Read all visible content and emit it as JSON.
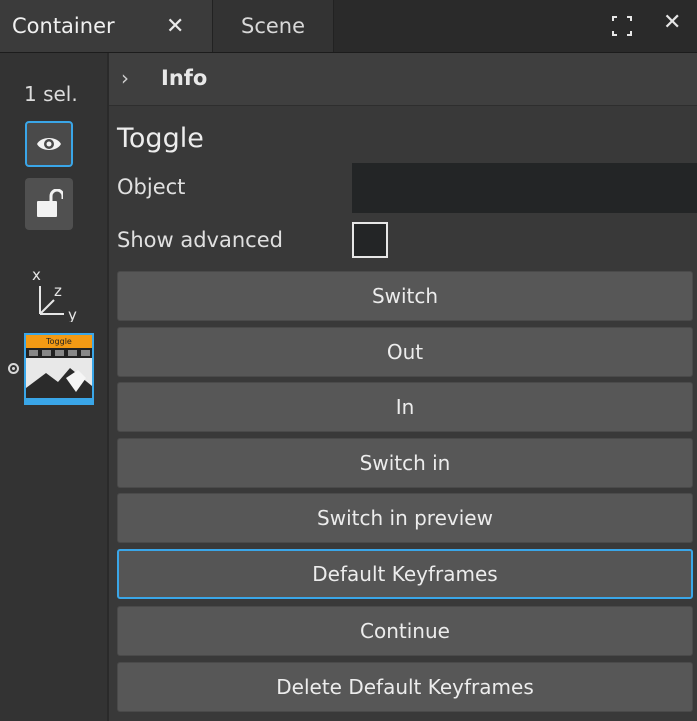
{
  "tabs": {
    "container": {
      "label": "Container",
      "close": "✕"
    },
    "scene": {
      "label": "Scene"
    }
  },
  "window": {
    "close": "✕",
    "expand_icon": "expand-icon"
  },
  "leftbar": {
    "selection_count": "1 sel.",
    "visibility_icon": "eye-icon",
    "lock_icon": "unlock-icon",
    "axis": {
      "x": "x",
      "y": "y",
      "z": "z"
    },
    "thumbnail_label": "Toggle"
  },
  "info": {
    "chevron": "›",
    "title": "Info"
  },
  "plugin": {
    "title": "Toggle",
    "object_label": "Object",
    "object_value": "",
    "show_advanced_label": "Show advanced",
    "show_advanced_checked": false
  },
  "buttons": [
    {
      "label": "Switch"
    },
    {
      "label": "Out"
    },
    {
      "label": "In"
    },
    {
      "label": "Switch in"
    },
    {
      "label": "Switch in preview"
    },
    {
      "label": "Default Keyframes"
    },
    {
      "label": "Continue"
    },
    {
      "label": "Delete Default Keyframes"
    }
  ],
  "colors": {
    "accent": "#3aa6e8",
    "thumbnail_header": "#f39a14"
  }
}
